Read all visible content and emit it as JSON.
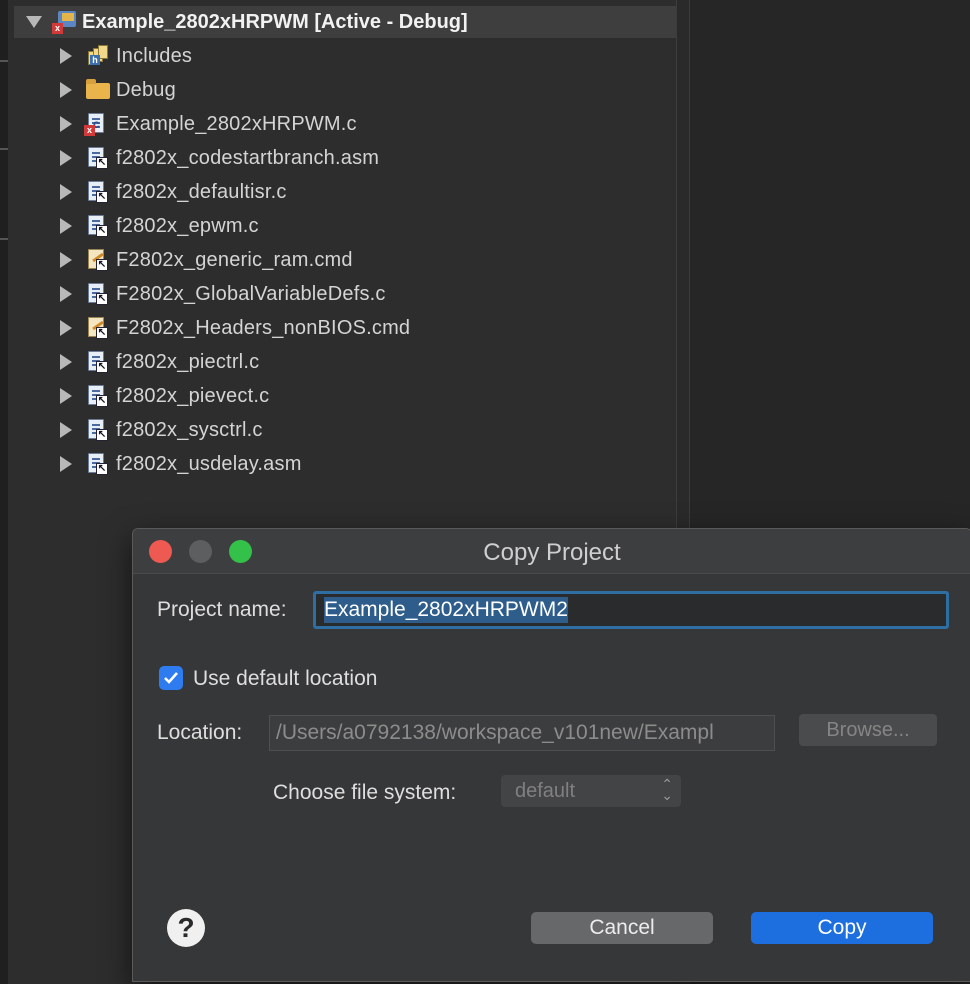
{
  "explorer": {
    "root": {
      "label": "Example_2802xHRPWM  [Active - Debug]",
      "icon": "project-error-icon"
    },
    "items": [
      {
        "label": "Includes",
        "icon": "includes-icon"
      },
      {
        "label": "Debug",
        "icon": "folder-icon"
      },
      {
        "label": "Example_2802xHRPWM.c",
        "icon": "c-file-error-icon"
      },
      {
        "label": "f2802x_codestartbranch.asm",
        "icon": "linked-file-icon"
      },
      {
        "label": "f2802x_defaultisr.c",
        "icon": "linked-file-icon"
      },
      {
        "label": "f2802x_epwm.c",
        "icon": "linked-file-icon"
      },
      {
        "label": "F2802x_generic_ram.cmd",
        "icon": "linked-cmd-file-icon"
      },
      {
        "label": "F2802x_GlobalVariableDefs.c",
        "icon": "linked-file-icon"
      },
      {
        "label": "F2802x_Headers_nonBIOS.cmd",
        "icon": "linked-cmd-file-icon"
      },
      {
        "label": "f2802x_piectrl.c",
        "icon": "linked-file-icon"
      },
      {
        "label": "f2802x_pievect.c",
        "icon": "linked-file-icon"
      },
      {
        "label": "f2802x_sysctrl.c",
        "icon": "linked-file-icon"
      },
      {
        "label": "f2802x_usdelay.asm",
        "icon": "linked-file-icon"
      }
    ]
  },
  "dialog": {
    "title": "Copy Project",
    "project_name_label": "Project name:",
    "project_name_value": "Example_2802xHRPWM2",
    "use_default_label": "Use default location",
    "use_default_checked": true,
    "location_label": "Location:",
    "location_value": "/Users/a0792138/workspace_v101new/Exampl",
    "browse_label": "Browse...",
    "file_system_label": "Choose file system:",
    "file_system_value": "default",
    "help_symbol": "?",
    "cancel_label": "Cancel",
    "copy_label": "Copy"
  },
  "colors": {
    "accent": "#1d6fe0",
    "checkbox": "#2f7cf0",
    "focus_ring": "#2f6ea3",
    "close": "#ee5a52",
    "zoom": "#34c14a"
  }
}
